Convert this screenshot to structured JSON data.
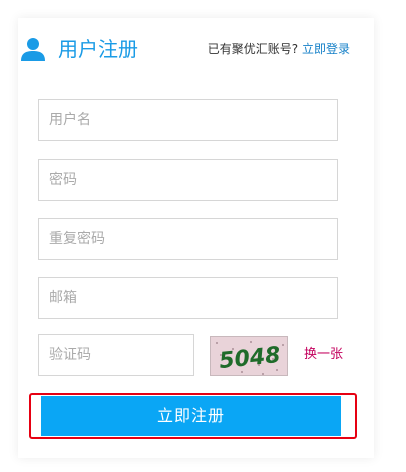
{
  "header": {
    "title": "用户注册",
    "login_prompt": "已有聚优汇账号?",
    "login_link": "立即登录"
  },
  "form": {
    "username_placeholder": "用户名",
    "password_placeholder": "密码",
    "repeat_password_placeholder": "重复密码",
    "email_placeholder": "邮箱",
    "captcha_placeholder": "验证码",
    "captcha_text": "5048",
    "refresh_captcha_label": "换一张",
    "submit_label": "立即注册"
  },
  "colors": {
    "accent": "#1a9be6",
    "button": "#0aa6f5",
    "refresh_link": "#c3005d",
    "highlight_border": "#e60012"
  },
  "icons": {
    "header": "user-icon"
  }
}
